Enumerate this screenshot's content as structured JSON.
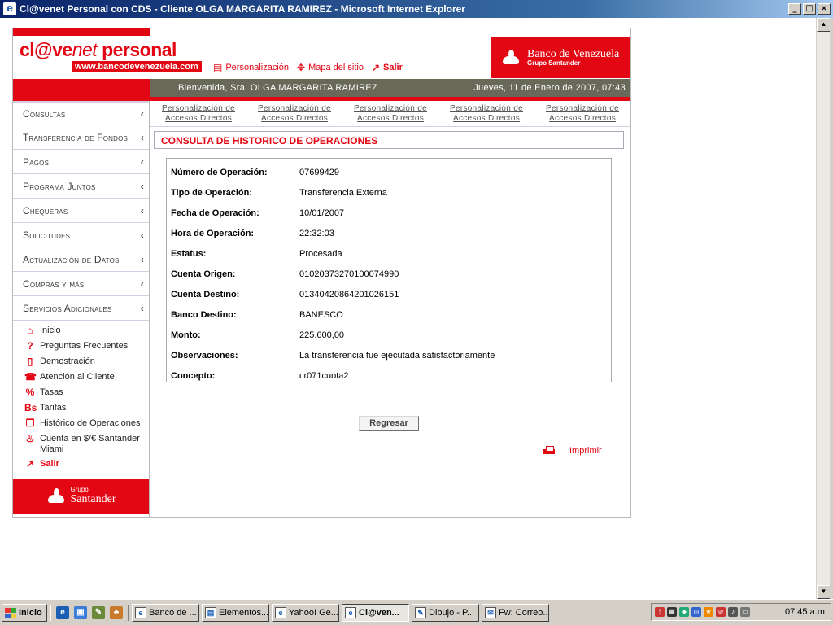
{
  "window": {
    "title": "Cl@venet Personal con CDS - Cliente OLGA MARGARITA RAMIREZ - Microsoft Internet Explorer",
    "min": "_",
    "max": "□",
    "close": "×"
  },
  "header": {
    "logo_main": "cl@ve",
    "logo_net": "net",
    "logo_tail": " personal",
    "logo_url": "www.bancodevenezuela.com",
    "links": {
      "personalizacion": "Personalización",
      "mapa": "Mapa del sitio",
      "salir": "Salir"
    },
    "bank_name": "Banco de Venezuela",
    "bank_group": "Grupo Santander"
  },
  "welcome": {
    "text": "Bienvenida, Sra.  OLGA MARGARITA RAMIREZ",
    "date": "Jueves, 11 de Enero de 2007, 07:43"
  },
  "sidebar": {
    "menu": [
      {
        "label": "Consultas"
      },
      {
        "label": "Transferencia de Fondos"
      },
      {
        "label": "Pagos"
      },
      {
        "label": "Programa Juntos"
      },
      {
        "label": "Chequeras"
      },
      {
        "label": "Solicitudes"
      },
      {
        "label": "Actualización de Datos"
      },
      {
        "label": "Compras y más"
      },
      {
        "label": "Servicios Adicionales"
      }
    ],
    "chev": "‹",
    "sublinks": {
      "inicio": "Inicio",
      "preguntas": "Preguntas Frecuentes",
      "demostracion": "Demostración",
      "atencion": "Atención al Cliente",
      "tasas": "Tasas",
      "tarifas": "Tarifas",
      "historico": "Histórico de Operaciones",
      "cuenta": "Cuenta en $/€ Santander Miami",
      "salir": "Salir"
    },
    "footer_group": "Grupo",
    "footer_brand": "Santander"
  },
  "quicklinks": [
    {
      "l1": "Personalización de",
      "l2": "Accesos Directos"
    },
    {
      "l1": "Personalización de",
      "l2": "Accesos Directos"
    },
    {
      "l1": "Personalización de",
      "l2": "Accesos Directos"
    },
    {
      "l1": "Personalización de",
      "l2": "Accesos Directos"
    },
    {
      "l1": "Personalización de",
      "l2": "Accesos Directos"
    }
  ],
  "main": {
    "title": "CONSULTA DE HISTORICO DE OPERACIONES",
    "rows": [
      {
        "label": "Número de Operación:",
        "value": "07699429"
      },
      {
        "label": "Tipo de Operación:",
        "value": "Transferencia Externa"
      },
      {
        "label": "Fecha de Operación:",
        "value": "10/01/2007"
      },
      {
        "label": "Hora de Operación:",
        "value": "22:32:03"
      },
      {
        "label": "Estatus:",
        "value": "Procesada"
      },
      {
        "label": "Cuenta Origen:",
        "value": "01020373270100074990"
      },
      {
        "label": "Cuenta Destino:",
        "value": "01340420864201026151"
      },
      {
        "label": "Banco Destino:",
        "value": "BANESCO"
      },
      {
        "label": "Monto:",
        "value": "225.600,00"
      },
      {
        "label": "Observaciones:",
        "value": "La transferencia fue ejecutada satisfactoriamente"
      },
      {
        "label": "Concepto:",
        "value": "cr071cuota2"
      }
    ],
    "back_button": "Regresar",
    "print": "Imprimir"
  },
  "taskbar": {
    "start": "Inicio",
    "buttons": [
      {
        "label": "Banco de ..."
      },
      {
        "label": "Elementos..."
      },
      {
        "label": "Yahoo! Ge..."
      },
      {
        "label": "Cl@ven..."
      },
      {
        "label": "Dibujo - P..."
      },
      {
        "label": "Fw: Correo..."
      }
    ],
    "clock": "07:45 a.m."
  }
}
